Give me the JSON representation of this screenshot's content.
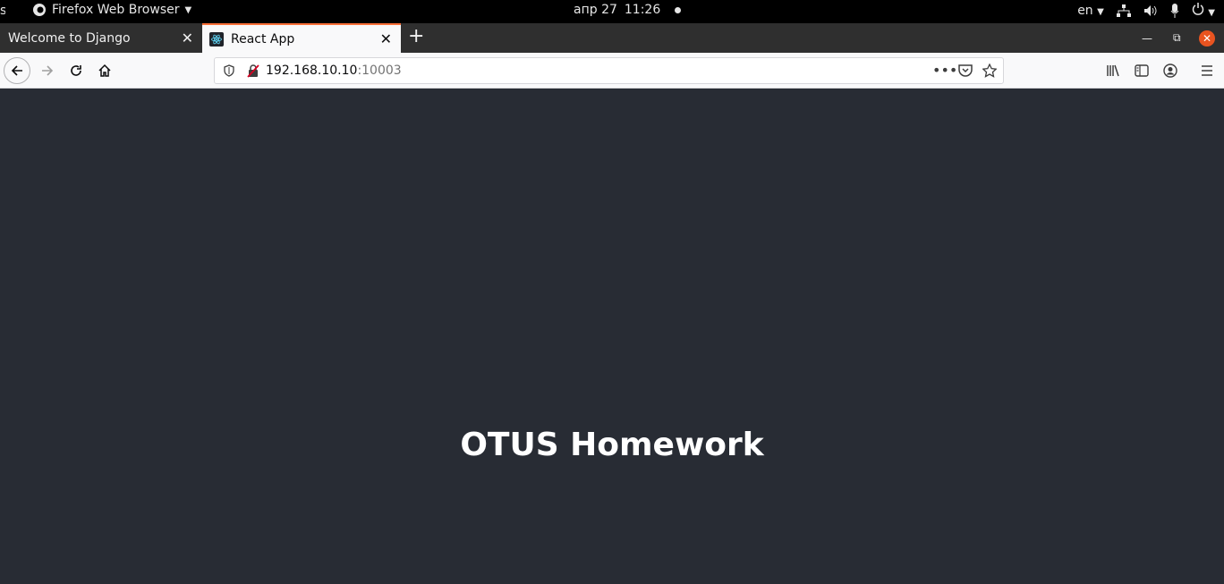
{
  "os_bar": {
    "activities_label": "s",
    "app_name": "Firefox Web Browser",
    "date": "апр 27",
    "time": "11:26",
    "language": "en"
  },
  "browser": {
    "tabs": [
      {
        "title": "Welcome to Django",
        "active": false
      },
      {
        "title": "React App",
        "active": true
      }
    ],
    "url_host": "192.168.10.10",
    "url_port": ":10003"
  },
  "page": {
    "heading": "OTUS Homework",
    "background": "#282c34"
  },
  "colors": {
    "accent_tab": "#ff7139",
    "close_button": "#e95420"
  }
}
